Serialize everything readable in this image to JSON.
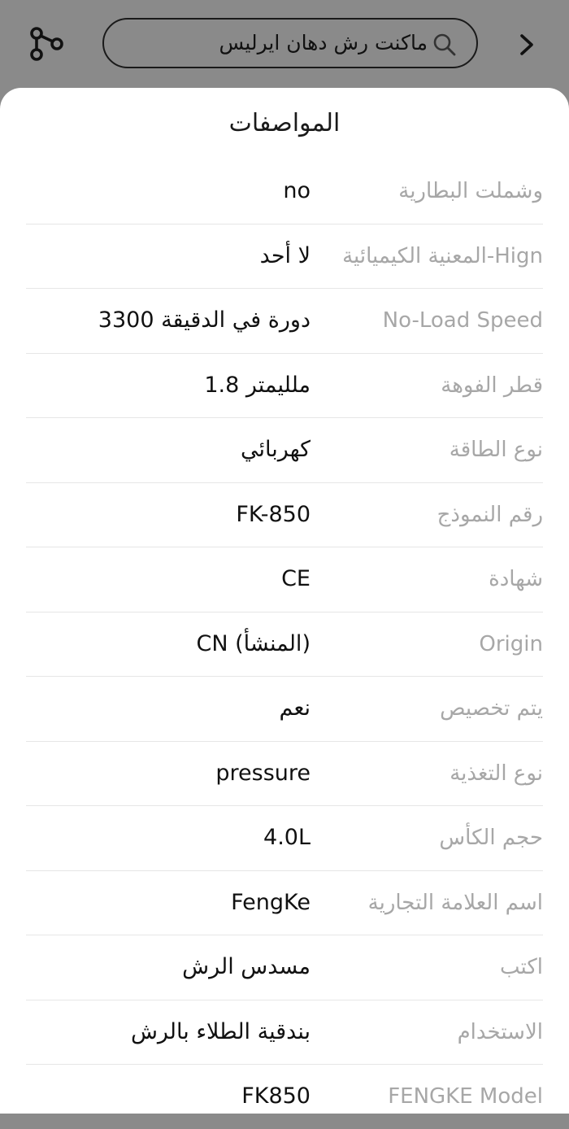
{
  "search": {
    "query": "ماكنت رش دهان ايرليس"
  },
  "sheet": {
    "title": "المواصفات"
  },
  "specs": [
    {
      "label": "وشملت البطارية",
      "value": "no"
    },
    {
      "label": "Hign-المعنية الكيميائية",
      "value": "لا أحد"
    },
    {
      "label": "No-Load Speed",
      "value": "3300 دورة في الدقيقة"
    },
    {
      "label": "قطر الفوهة",
      "value": "1.8 ملليمتر"
    },
    {
      "label": "نوع الطاقة",
      "value": "كهربائي"
    },
    {
      "label": "رقم النموذج",
      "value": "FK-850"
    },
    {
      "label": "شهادة",
      "value": "CE"
    },
    {
      "label": "Origin",
      "value": "CN (المنشأ)"
    },
    {
      "label": "يتم تخصيص",
      "value": "نعم"
    },
    {
      "label": "نوع التغذية",
      "value": "pressure"
    },
    {
      "label": "حجم الكأس",
      "value": "4.0L"
    },
    {
      "label": "اسم العلامة التجارية",
      "value": "FengKe"
    },
    {
      "label": "اكتب",
      "value": "مسدس الرش"
    },
    {
      "label": "الاستخدام",
      "value": "بندقية الطلاء بالرش"
    },
    {
      "label": "FENGKE Model",
      "value": "FK850"
    }
  ],
  "icons": {
    "share": "share-icon",
    "search": "search-icon",
    "back": "chevron-right-icon"
  }
}
